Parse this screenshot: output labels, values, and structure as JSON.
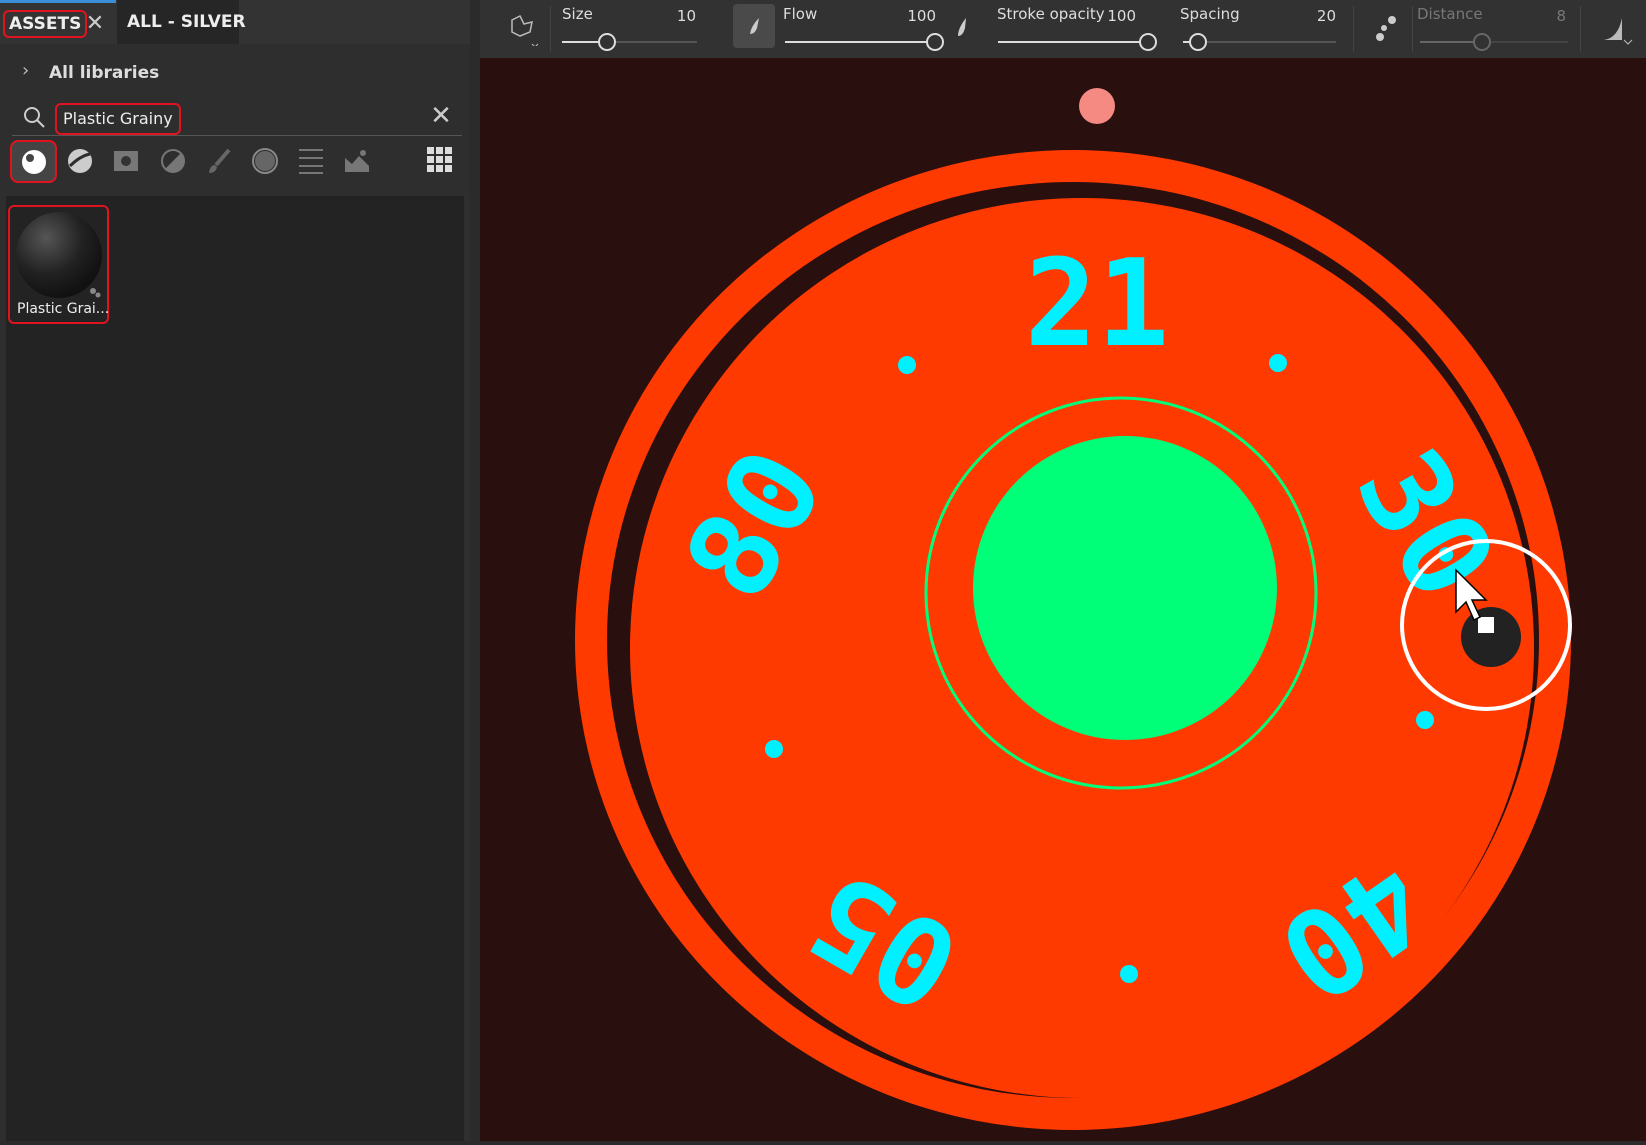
{
  "panel": {
    "tabs": [
      {
        "label": "ASSETS",
        "active": true
      },
      {
        "label": "ALL - SILVER",
        "active": false
      }
    ],
    "close_icon": "close-icon",
    "breadcrumb": "All libraries",
    "search": {
      "value": "Plastic Grainy",
      "placeholder": ""
    },
    "filters": [
      "material",
      "smart-material",
      "texture",
      "mask",
      "brush",
      "particle",
      "filter",
      "environment"
    ],
    "results": [
      {
        "label": "Plastic Grai..."
      }
    ]
  },
  "toolbar": {
    "size": {
      "label": "Size",
      "value": "10",
      "fraction": 0.33
    },
    "flow": {
      "label": "Flow",
      "value": "100",
      "fraction": 1.0
    },
    "stroke_opacity": {
      "label": "Stroke opacity",
      "value": "100",
      "fraction": 1.0
    },
    "spacing": {
      "label": "Spacing",
      "value": "20",
      "fraction": 0.05
    },
    "distance": {
      "label": "Distance",
      "value": "8",
      "fraction": 0.4,
      "disabled": true
    }
  },
  "viewport": {
    "labels": [
      "21",
      "80",
      "30",
      "05",
      "40"
    ],
    "colors": {
      "background": "#2a0f0f",
      "red": "#ff3a00",
      "green": "#00ff78",
      "cyan": "#00f0ff",
      "pink": "#f48a82"
    }
  }
}
